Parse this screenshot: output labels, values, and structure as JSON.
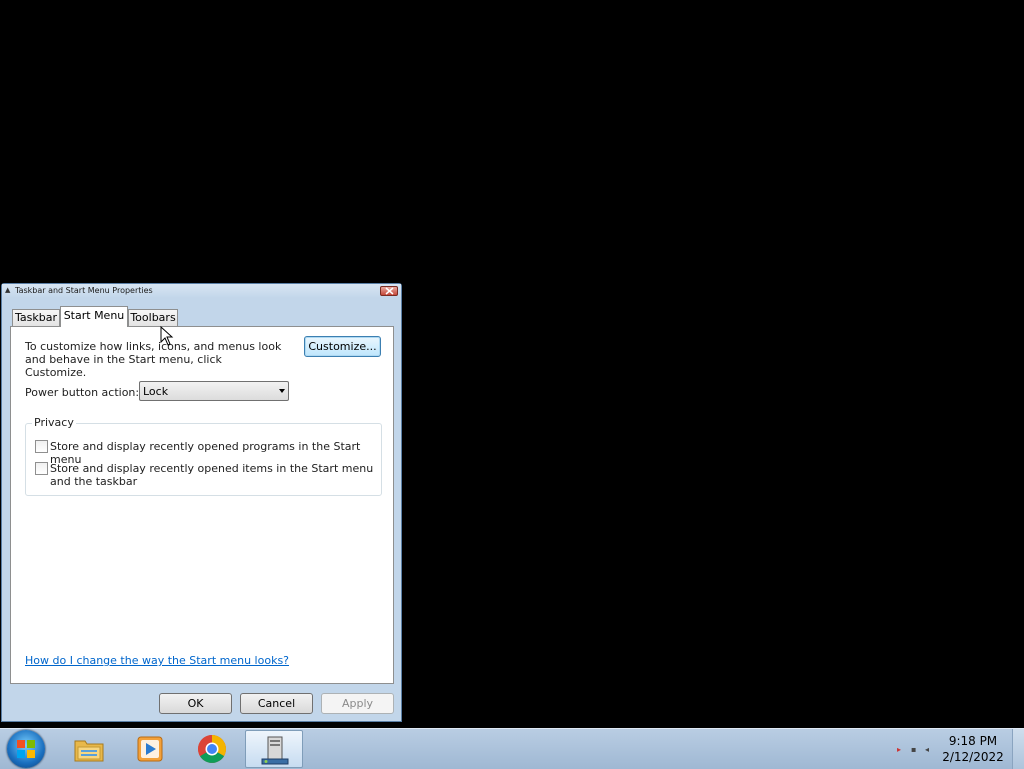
{
  "dialog": {
    "title": "Taskbar and Start Menu Properties",
    "tabs": [
      {
        "label": "Taskbar"
      },
      {
        "label": "Start Menu"
      },
      {
        "label": "Toolbars"
      }
    ],
    "description": "To customize how links, icons, and menus look and behave in the Start menu, click Customize.",
    "customize_label": "Customize...",
    "power_label": "Power button action:",
    "power_value": "Lock",
    "privacy": {
      "label": "Privacy",
      "options": [
        {
          "label": "Store and display recently opened programs in the Start menu",
          "checked": false
        },
        {
          "label": "Store and display recently opened items in the Start menu and the taskbar",
          "checked": false
        }
      ]
    },
    "help_link": "How do I change the way the Start menu looks?",
    "buttons": {
      "ok": "OK",
      "cancel": "Cancel",
      "apply": "Apply"
    }
  },
  "taskbar": {
    "items": [
      {
        "icon": "start-orb-icon"
      },
      {
        "icon": "folder-icon"
      },
      {
        "icon": "media-player-icon"
      },
      {
        "icon": "chrome-icon"
      },
      {
        "icon": "taskbar-properties-icon",
        "active": true
      }
    ],
    "clock": {
      "time": "9:18 PM",
      "date": "2/12/2022"
    }
  },
  "colors": {
    "accent": "#3c7fb1",
    "link": "#0066cc",
    "desktop": "#000000"
  }
}
